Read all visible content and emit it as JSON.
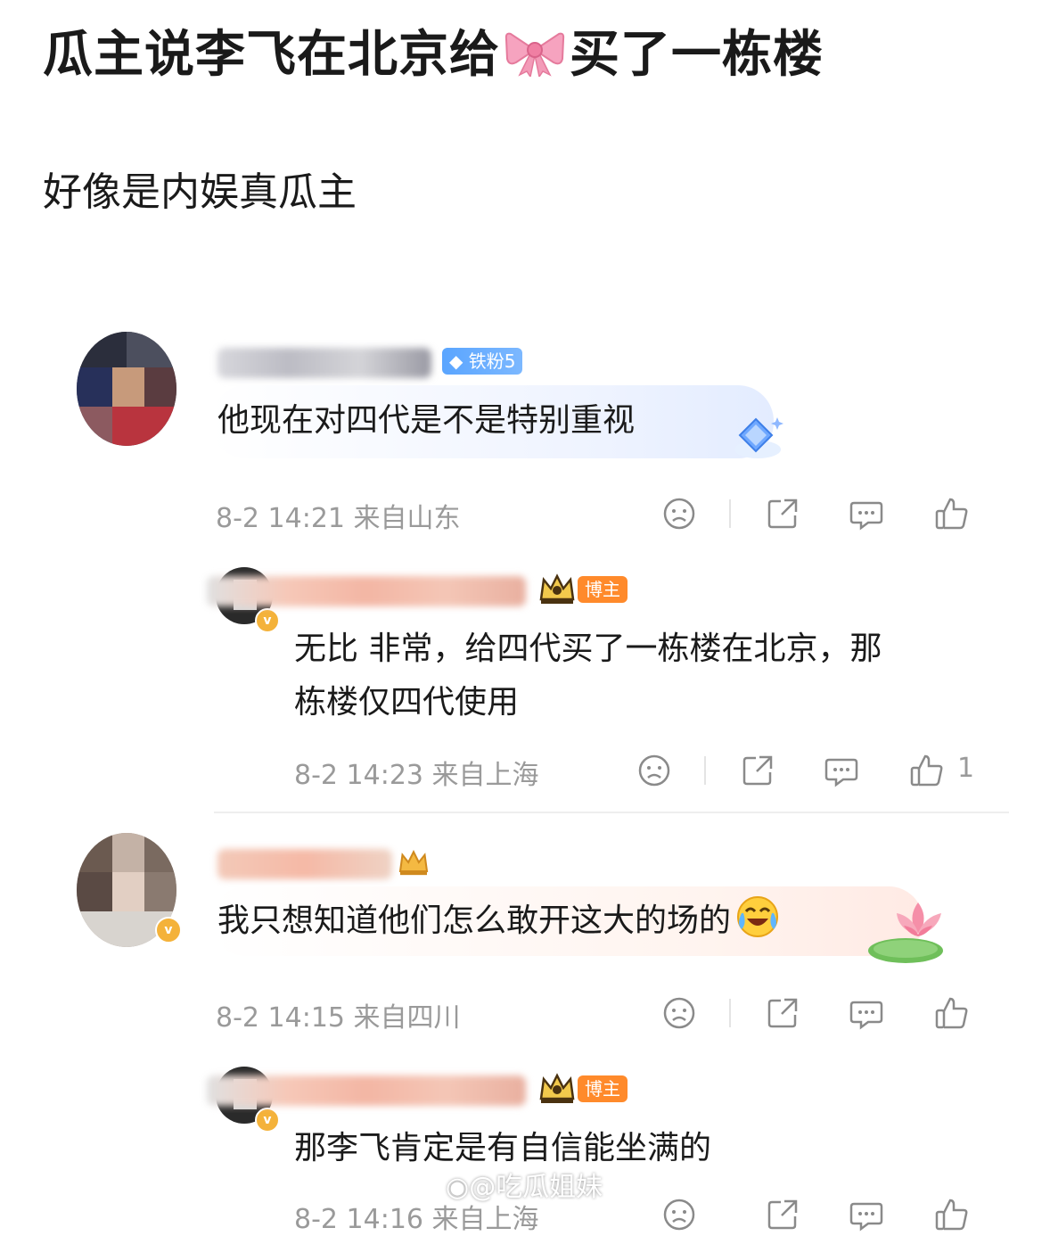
{
  "post": {
    "title_left": "瓜主说李飞在北京给",
    "title_right": "买了一栋楼",
    "bow_icon": "ribbon-bow-icon",
    "subtitle": "好像是内娱真瓜主"
  },
  "colors": {
    "fan_badge": "#5aa5ff",
    "host_badge": "#ff8a2b",
    "meta": "#9a9a9a"
  },
  "comments": [
    {
      "badge": "铁粉5",
      "text": "他现在对四代是不是特别重视",
      "time": "8-2 14:21",
      "location": "来自山东",
      "reply": {
        "badge": "博主",
        "text_line1": "无比 非常，给四代买了一栋楼在北京，那",
        "text_line2": "栋楼仅四代使用",
        "time": "8-2 14:23",
        "location": "来自上海",
        "likes": "1"
      }
    },
    {
      "text": "我只想知道他们怎么敢开这大的场的",
      "emoji": "laugh-cry-emoji",
      "time": "8-2 14:15",
      "location": "来自四川",
      "reply": {
        "badge": "博主",
        "text_line1": "那李飞肯定是有自信能坐满的",
        "time": "8-2 14:16",
        "location": "来自上海"
      }
    }
  ],
  "watermark": "@吃瓜姐妹"
}
